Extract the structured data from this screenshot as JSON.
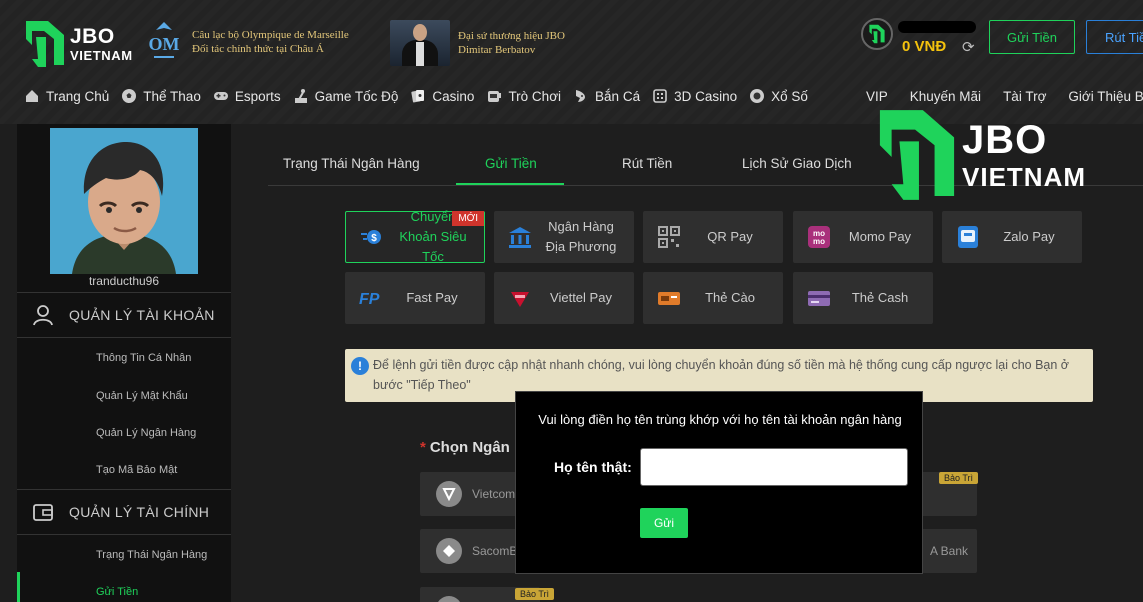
{
  "header": {
    "logo": {
      "line1": "JBO",
      "line2": "VIETNAM"
    },
    "partner": {
      "line1": "Câu lạc bộ Olympique de Marseille",
      "line2": "Đối tác chính thức tại Châu Á"
    },
    "ambassador": {
      "line1": "Đại sứ thương hiệu JBO",
      "line2": "Dimitar Berbatov"
    },
    "balance": "0 VNĐ",
    "deposit_button": "Gửi Tiền",
    "withdraw_button": "Rút Tiền"
  },
  "nav": {
    "left": [
      {
        "label": "Trang Chủ",
        "icon": "home-icon"
      },
      {
        "label": "Thể Thao",
        "icon": "soccer-ball-icon"
      },
      {
        "label": "Esports",
        "icon": "gamepad-icon"
      },
      {
        "label": "Game Tốc Độ",
        "icon": "joystick-icon"
      },
      {
        "label": "Casino",
        "icon": "cards-icon"
      },
      {
        "label": "Trò Chơi",
        "icon": "slot-machine-icon"
      },
      {
        "label": "Bắn Cá",
        "icon": "fish-icon"
      },
      {
        "label": "3D Casino",
        "icon": "3d-icon"
      },
      {
        "label": "Xổ Số",
        "icon": "lottery-icon"
      }
    ],
    "right": [
      "VIP",
      "Khuyến Mãi",
      "Tài Trợ",
      "Giới Thiệu Bạn Bè"
    ]
  },
  "sidebar": {
    "username": "tranducthu96",
    "account_section": "QUẢN LÝ TÀI KHOẢN",
    "account_links": [
      "Thông Tin Cá Nhân",
      "Quản Lý Mật Khẩu",
      "Quản Lý Ngân Hàng",
      "Tạo Mã Bảo Mật"
    ],
    "finance_section": "QUẢN LÝ TÀI CHÍNH",
    "finance_links": [
      "Trạng Thái Ngân Hàng",
      "Gửi Tiền"
    ]
  },
  "tabs": [
    "Trạng Thái Ngân Hàng",
    "Gửi Tiền",
    "Rút Tiền",
    "Lịch Sử Giao Dịch"
  ],
  "methods": [
    {
      "label": "Chuyển Khoản Siêu Tốc",
      "icon": "fast-transfer-icon",
      "badge": "MỚI"
    },
    {
      "label": "Ngân Hàng Địa Phương",
      "icon": "bank-building-icon"
    },
    {
      "label": "QR Pay",
      "icon": "qr-code-icon"
    },
    {
      "label": "Momo Pay",
      "icon": "momo-icon"
    },
    {
      "label": "Zalo Pay",
      "icon": "zalo-icon"
    },
    {
      "label": "Fast Pay",
      "icon": "fastpay-icon"
    },
    {
      "label": "Viettel Pay",
      "icon": "viettel-icon"
    },
    {
      "label": "Thẻ Cào",
      "icon": "scratch-card-icon"
    },
    {
      "label": "Thẻ Cash",
      "icon": "cash-card-icon"
    }
  ],
  "notice": "Để lệnh gửi tiền được cập nhật nhanh chóng, vui lòng chuyển khoản đúng số tiền mà hệ thống cung cấp ngược lại cho Bạn ở bước \"Tiếp Theo\"",
  "bank_select_label": "Chọn Ngân Hàng",
  "banks": [
    {
      "name": "Vietcombank"
    },
    {
      "name": "SacomBank"
    },
    {
      "name": "A Bank"
    }
  ],
  "maintenance_badge": "Bảo Trì",
  "watermark": {
    "line1": "JBO",
    "line2": "VIETNAM"
  },
  "modal": {
    "title": "Vui lòng điền họ tên trùng khớp với họ tên tài khoản ngân hàng",
    "label": "Họ tên thật:",
    "input_value": "",
    "submit": "Gửi"
  },
  "colors": {
    "accent": "#1fd35b",
    "gold": "#f4c20d",
    "blue": "#2a80d9",
    "danger": "#d0342c"
  }
}
